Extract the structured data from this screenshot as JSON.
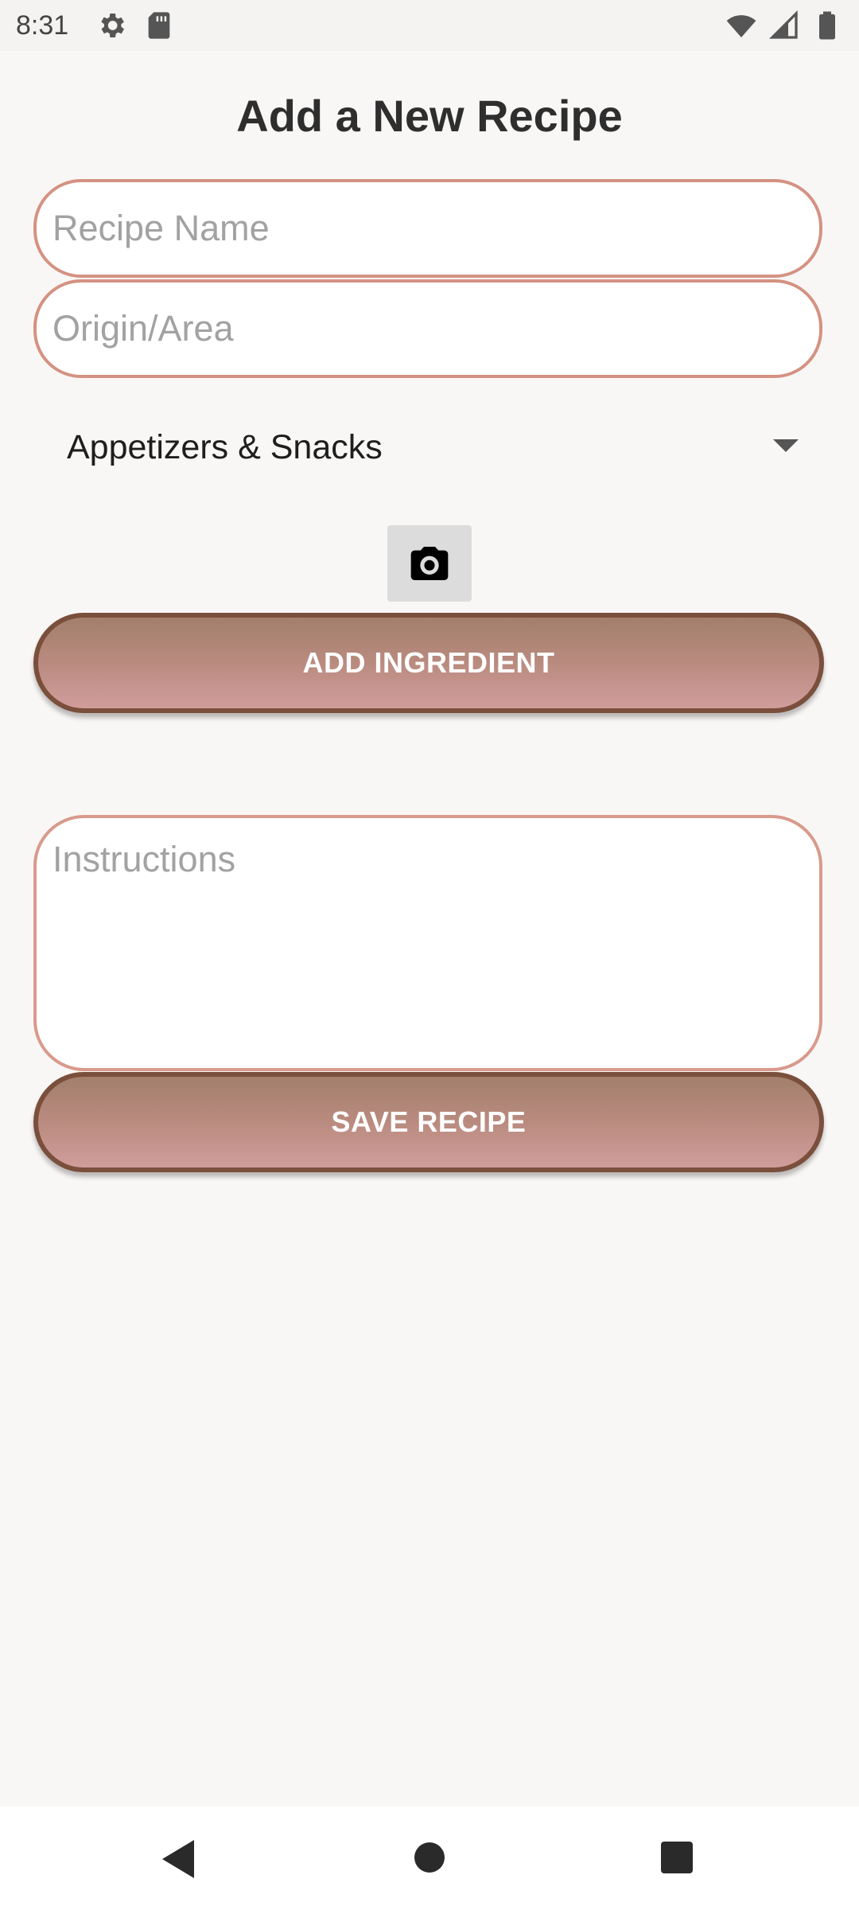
{
  "status_bar": {
    "time": "8:31",
    "left_icons": [
      "gear-icon",
      "sd-card-icon"
    ],
    "right_icons": [
      "wifi-icon",
      "signal-icon",
      "battery-icon"
    ]
  },
  "page": {
    "title": "Add a New Recipe"
  },
  "form": {
    "recipe_name_placeholder": "Recipe Name",
    "origin_placeholder": "Origin/Area",
    "category_selected": "Appetizers & Snacks",
    "camera_icon": "camera-icon",
    "add_ingredient_label": "ADD INGREDIENT",
    "instructions_placeholder": "Instructions",
    "save_recipe_label": "SAVE RECIPE"
  },
  "colors": {
    "background": "#f9f7f5",
    "field_border": "#d49282",
    "button_border": "#7a4f3c",
    "button_gradient_top": "#a37f6c",
    "button_gradient_bottom": "#d19d9c"
  },
  "nav_bar": {
    "icons": [
      "back-icon",
      "home-icon",
      "recents-icon"
    ]
  }
}
